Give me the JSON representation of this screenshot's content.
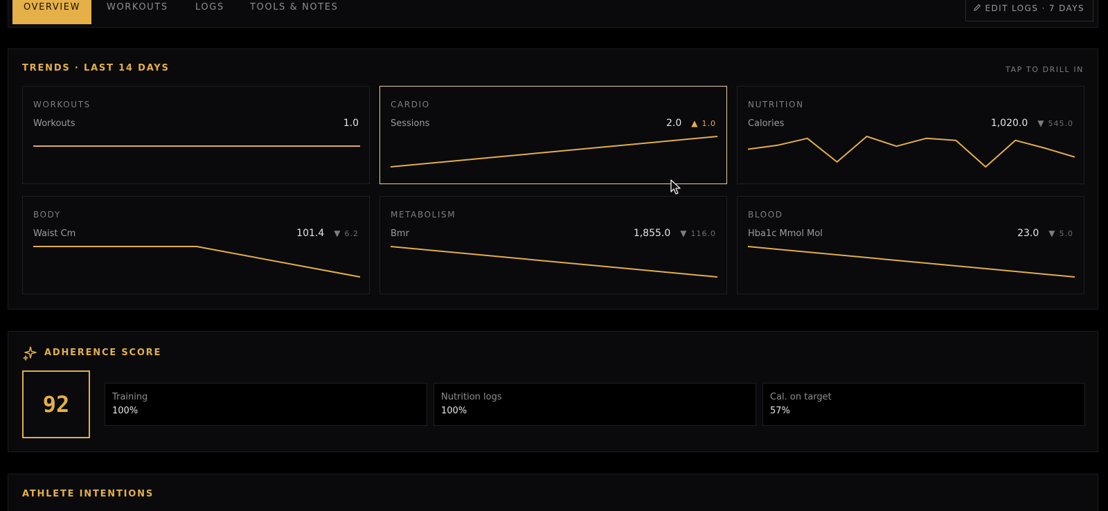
{
  "nav": {
    "tabs": [
      {
        "label": "Overview",
        "active": true
      },
      {
        "label": "Workouts",
        "active": false
      },
      {
        "label": "Logs",
        "active": false
      },
      {
        "label": "Tools & Notes",
        "active": false
      }
    ],
    "edit_logs": "Edit logs · 7 days"
  },
  "trends": {
    "title": "Trends · Last 14 days",
    "hint": "Tap to drill in",
    "cards": [
      {
        "category": "Workouts",
        "metric": "Workouts",
        "value": "1.0",
        "direction": "",
        "delta": "",
        "points": [
          1,
          1
        ]
      },
      {
        "category": "Cardio",
        "metric": "Sessions",
        "value": "2.0",
        "direction": "up",
        "delta": "1.0",
        "points": [
          1,
          2
        ],
        "selected": true
      },
      {
        "category": "Nutrition",
        "metric": "Calories",
        "value": "1,020.0",
        "direction": "down",
        "delta": "545.0",
        "points": [
          1450,
          1490,
          1560,
          1320,
          1580,
          1480,
          1560,
          1540,
          1270,
          1540,
          1460,
          1370
        ]
      },
      {
        "category": "Body",
        "metric": "Waist Cm",
        "value": "101.4",
        "direction": "down",
        "delta": "6.2",
        "points": [
          107.6,
          107.6,
          101.4
        ]
      },
      {
        "category": "Metabolism",
        "metric": "Bmr",
        "value": "1,855.0",
        "direction": "down",
        "delta": "116.0",
        "points": [
          1971,
          1855
        ]
      },
      {
        "category": "Blood",
        "metric": "Hba1c Mmol Mol",
        "value": "23.0",
        "direction": "down",
        "delta": "5.0",
        "points": [
          28,
          23
        ]
      }
    ]
  },
  "adherence": {
    "title": "Adherence score",
    "score": "92",
    "stats": [
      {
        "label": "Training",
        "value": "100%"
      },
      {
        "label": "Nutrition logs",
        "value": "100%"
      },
      {
        "label": "Cal. on target",
        "value": "57%"
      }
    ]
  },
  "intentions": {
    "title": "Athlete intentions"
  },
  "colors": {
    "accent": "#e4b047",
    "background": "#000000",
    "panel": "#0a0a0c"
  }
}
